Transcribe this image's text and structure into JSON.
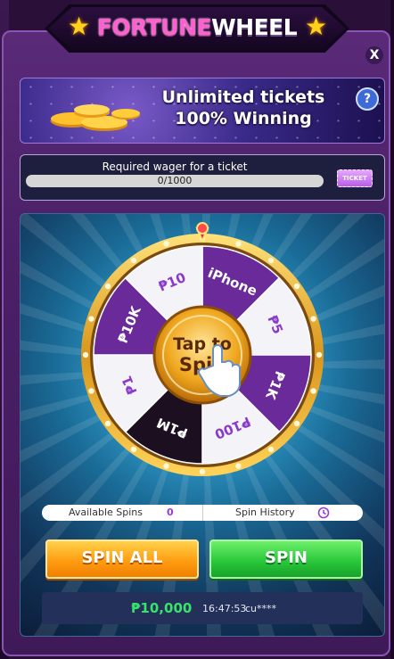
{
  "title": {
    "part1": "FORTUNE",
    "part2": "WHEEL"
  },
  "close_label": "X",
  "promo": {
    "line1": "Unlimited tickets",
    "line2": "100% Winning",
    "help_label": "?"
  },
  "wager": {
    "label": "Required wager for a ticket",
    "progress_text": "0/1000",
    "progress": 0,
    "ticket_label": "TICKET"
  },
  "wheel": {
    "center_line1": "Tap to",
    "center_line2": "Spin",
    "segments": [
      "iPhone",
      "₱5",
      "₱1K",
      "₱100",
      "₱1M",
      "₱1",
      "₱10K",
      "₱10"
    ]
  },
  "available_spins": {
    "label": "Available Spins",
    "count": "0"
  },
  "spin_history": {
    "label": "Spin History"
  },
  "buttons": {
    "spin_all": "SPIN ALL",
    "spin": "SPIN"
  },
  "ticker": {
    "amount": "₱10,000",
    "time": "16:47:53",
    "user": "cu****"
  },
  "colors": {
    "purple": "#6a2a9a",
    "white": "#f4f4f8",
    "gold": "#f2c23a",
    "green": "#2bc83c",
    "orange": "#ff9d12"
  }
}
